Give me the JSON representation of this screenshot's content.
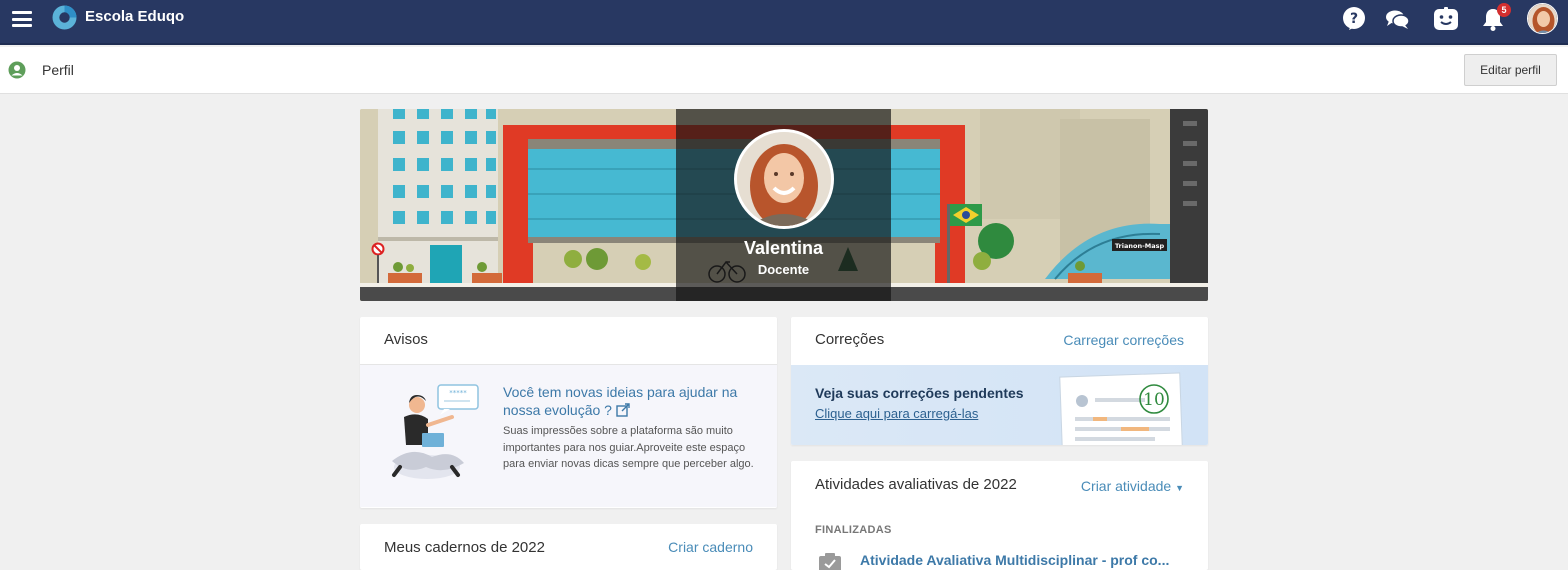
{
  "header": {
    "brand": "Escola Eduqo",
    "notification_count": "5",
    "accent": "#283862"
  },
  "subheader": {
    "title": "Perfil",
    "edit_label": "Editar perfil"
  },
  "profile": {
    "name": "Valentina",
    "role": "Docente",
    "banner_sign": "Trianon-Masp"
  },
  "avisos": {
    "title": "Avisos",
    "heading": "Você tem novas ideias para ajudar na nossa evolução ?",
    "text": "Suas impressões sobre a plataforma são muito importantes para nos guiar.Aproveite este espaço para enviar novas dicas sempre que perceber algo."
  },
  "cadernos": {
    "title": "Meus cadernos de 2022",
    "action": "Criar caderno"
  },
  "correcoes": {
    "title": "Correções",
    "action": "Carregar correções",
    "heading": "Veja suas correções pendentes",
    "link": "Clique aqui para carregá-las",
    "grade": "10"
  },
  "atividades": {
    "title": "Atividades avaliativas de 2022",
    "action": "Criar atividade",
    "section": "FINALIZADAS",
    "items": [
      {
        "label": "Atividade Avaliativa Multidisciplinar - prof co..."
      }
    ]
  }
}
